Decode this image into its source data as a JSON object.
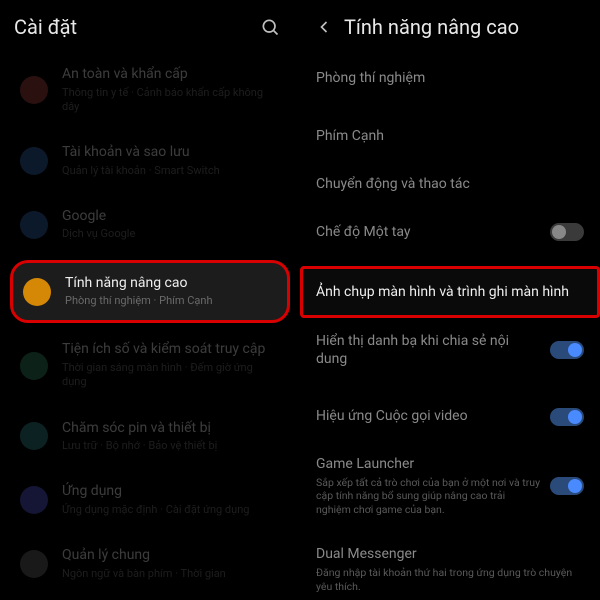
{
  "left": {
    "title": "Cài đặt",
    "items": [
      {
        "title": "An toàn và khẩn cấp",
        "subtitle": "Thông tin y tế · Cảnh báo khẩn cấp không dây",
        "icon_color": "#9a3a3a"
      },
      {
        "title": "Tài khoản và sao lưu",
        "subtitle": "Quản lý tài khoản · Smart Switch",
        "icon_color": "#2a5a9a"
      },
      {
        "title": "Google",
        "subtitle": "Dịch vụ Google",
        "icon_color": "#2a5a9a"
      },
      {
        "title": "Tính năng nâng cao",
        "subtitle": "Phòng thí nghiệm · Phím Cạnh",
        "icon_color": "#d48806",
        "highlighted": true
      },
      {
        "title": "Tiện ích số và kiểm soát truy cập",
        "subtitle": "Thời gian sáng màn hình · Đếm giờ ứng dụng",
        "icon_color": "#2a7a5a"
      },
      {
        "title": "Chăm sóc pin và thiết bị",
        "subtitle": "Lưu trữ · Bộ nhớ · Bảo vệ thiết bị",
        "icon_color": "#2a7a7a"
      },
      {
        "title": "Ứng dụng",
        "subtitle": "Ứng dụng mặc định · Cài đặt ứng dụng",
        "icon_color": "#4a4ac0"
      },
      {
        "title": "Quản lý chung",
        "subtitle": "Ngôn ngữ và bàn phím · Thời gian",
        "icon_color": "#5a5a5a"
      }
    ]
  },
  "right": {
    "title": "Tính năng nâng cao",
    "rows": [
      {
        "title": "Phòng thí nghiệm"
      },
      {
        "spacer": true
      },
      {
        "title": "Phím Cạnh"
      },
      {
        "title": "Chuyển động và thao tác"
      },
      {
        "title": "Chế độ Một tay",
        "toggle": "off"
      },
      {
        "spacer": true
      },
      {
        "title": "Ảnh chụp màn hình và trình ghi màn hình",
        "highlighted": true
      },
      {
        "title": "Hiển thị danh bạ khi chia sẻ nội dung",
        "toggle": "on"
      },
      {
        "spacer": true
      },
      {
        "title": "Hiệu ứng Cuộc gọi video",
        "toggle": "on"
      },
      {
        "title": "Game Launcher",
        "subtitle": "Sắp xếp tất cả trò chơi của bạn ở một nơi và truy cập tính năng bổ sung giúp nâng cao trải nghiệm chơi game của bạn.",
        "toggle": "on"
      },
      {
        "title": "Dual Messenger",
        "subtitle": "Đăng nhập tài khoản thứ hai trong ứng dụng trò chuyện yêu thích."
      }
    ]
  }
}
